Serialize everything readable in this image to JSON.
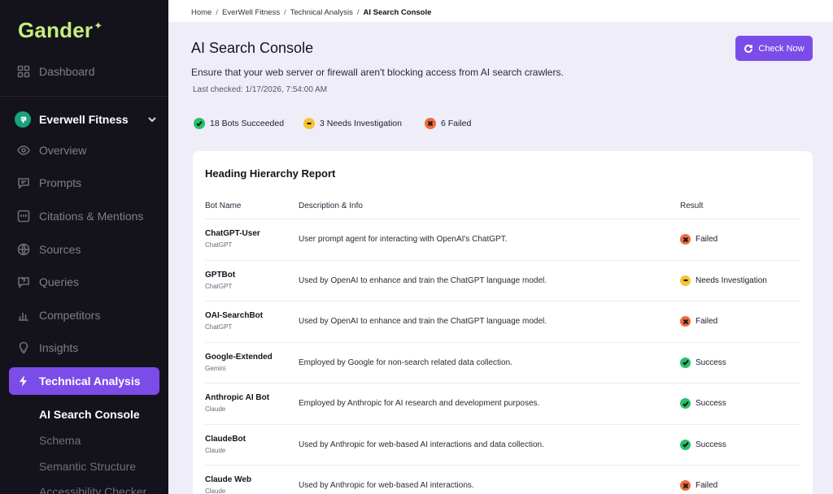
{
  "app": {
    "logo": "Gander",
    "logo_mark": "✦"
  },
  "sidebar": {
    "dashboard": "Dashboard",
    "workspace": "Everwell Fitness",
    "items": [
      "Overview",
      "Prompts",
      "Citations & Mentions",
      "Sources",
      "Queries",
      "Competitors",
      "Insights"
    ],
    "active": "Technical Analysis",
    "sub_items": [
      "AI Search Console",
      "Schema",
      "Semantic Structure",
      "Accessibility Checker"
    ]
  },
  "breadcrumb": [
    "Home",
    "EverWell Fitness",
    "Technical Analysis",
    "AI Search Console"
  ],
  "page": {
    "title": "AI Search Console",
    "subtitle": "Ensure that your web server or firewall aren't blocking access from AI search crawlers.",
    "last_checked": "Last checked: 1/17/2026, 7:54:00 AM",
    "check_button": "Check Now"
  },
  "summary": {
    "succeeded": "18 Bots Succeeded",
    "investigation": "3 Needs Investigation",
    "failed": "6 Failed"
  },
  "report": {
    "title": "Heading Hierarchy Report",
    "columns": [
      "Bot Name",
      "Description & Info",
      "Result"
    ],
    "rows": [
      {
        "name": "ChatGPT-User",
        "org": "ChatGPT",
        "desc": "User prompt agent for interacting with OpenAI's ChatGPT.",
        "result": "Failed",
        "status": "fail"
      },
      {
        "name": "GPTBot",
        "org": "ChatGPT",
        "desc": "Used by OpenAI to enhance and train the ChatGPT language model.",
        "result": "Needs Investigation",
        "status": "warn"
      },
      {
        "name": "OAI-SearchBot",
        "org": "ChatGPT",
        "desc": "Used by OpenAI to enhance and train the ChatGPT language model.",
        "result": "Failed",
        "status": "fail"
      },
      {
        "name": "Google-Extended",
        "org": "Gemini",
        "desc": "Employed by Google for non-search related data collection.",
        "result": "Success",
        "status": "ok"
      },
      {
        "name": "Anthropic AI Bot",
        "org": "Claude",
        "desc": "Employed by Anthropic for AI research and development purposes.",
        "result": "Success",
        "status": "ok"
      },
      {
        "name": "ClaudeBot",
        "org": "Claude",
        "desc": "Used by Anthropic for web-based AI interactions and data collection.",
        "result": "Success",
        "status": "ok"
      },
      {
        "name": "Claude Web",
        "org": "Claude",
        "desc": "Used by Anthropic for web-based AI interactions.",
        "result": "Failed",
        "status": "fail"
      }
    ]
  },
  "colors": {
    "accent": "#7c4ce9",
    "sidebar_bg": "#14131c",
    "logo": "#c3ef7a",
    "success": "#25c26b",
    "warning": "#f5c431",
    "failed": "#f06a3b"
  },
  "icons": [
    "grid-icon",
    "chevron-down-icon",
    "eye-icon",
    "chat-icon",
    "quote-icon",
    "globe-icon",
    "question-icon",
    "bar-chart-icon",
    "lightbulb-icon",
    "bolt-icon",
    "refresh-icon",
    "check-icon",
    "minus-icon",
    "x-icon"
  ]
}
